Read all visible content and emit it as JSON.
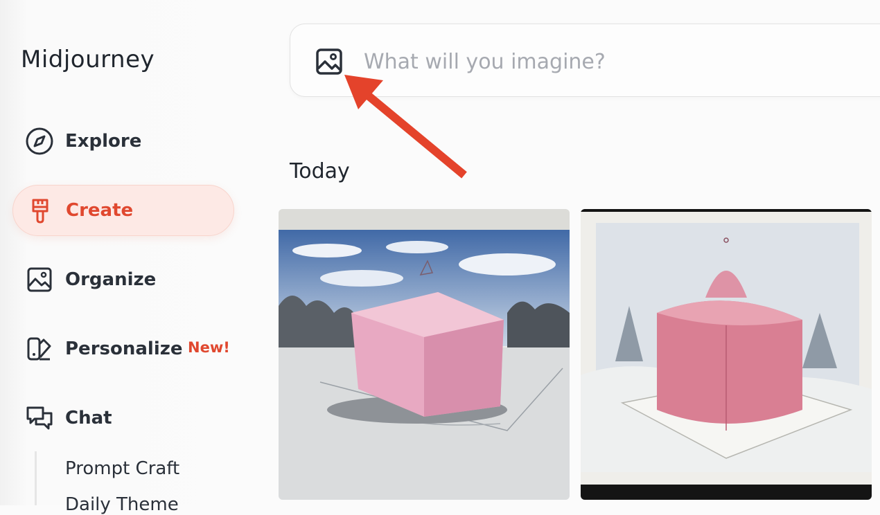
{
  "app": {
    "name": "Midjourney"
  },
  "sidebar": {
    "items": [
      {
        "label": "Explore",
        "icon": "compass-icon"
      },
      {
        "label": "Create",
        "icon": "paintbrush-icon",
        "active": true
      },
      {
        "label": "Organize",
        "icon": "image-icon"
      },
      {
        "label": "Personalize",
        "icon": "personalize-icon",
        "badge": "New!"
      },
      {
        "label": "Chat",
        "icon": "chat-bubbles-icon"
      }
    ],
    "chat_subitems": [
      "Prompt Craft",
      "Daily Theme"
    ]
  },
  "search": {
    "placeholder": "What will you imagine?",
    "value": "",
    "image_button_icon": "image-icon"
  },
  "main": {
    "section_title": "Today",
    "images": [
      {
        "description": "pink-cube-sketch",
        "alt": "Pink cube sculpture drawing"
      },
      {
        "description": "pink-cake-sketch",
        "alt": "Pink cake sketch"
      }
    ]
  },
  "colors": {
    "accent": "#e0482f",
    "active_bg": "#fde9e5",
    "text": "#222831",
    "placeholder": "#a6a9b0",
    "annotation_arrow": "#e4432b"
  }
}
